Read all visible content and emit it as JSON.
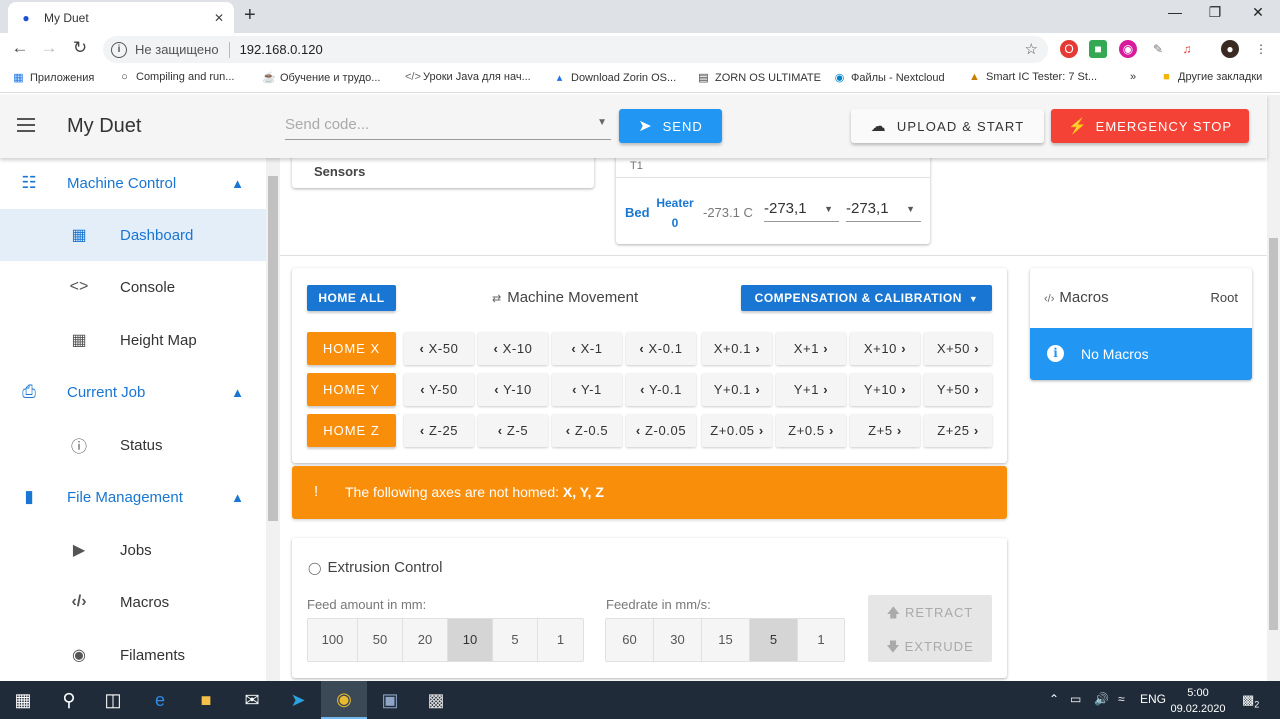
{
  "browser": {
    "tab_title": "My Duet",
    "security_label": "Не защищено",
    "url": "192.168.0.120",
    "bookmarks": [
      "Приложения",
      "Compiling and run...",
      "Обучение и трудо...",
      "Уроки Java для нач...",
      "Download Zorin OS...",
      "ZORN OS ULTIMATE",
      "Файлы - Nextcloud",
      "Smart IC Tester: 7 St...",
      "Другие закладки"
    ],
    "more_bookmarks": "»"
  },
  "appbar": {
    "title": "My Duet",
    "send_placeholder": "Send code...",
    "send_label": "SEND",
    "upload_label": "UPLOAD & START",
    "estop_label": "EMERGENCY STOP"
  },
  "sidebar": {
    "groups": [
      {
        "label": "Machine Control",
        "icon": "tune-icon"
      },
      {
        "label": "Current Job",
        "icon": "printer-icon"
      },
      {
        "label": "File Management",
        "icon": "sd-card-icon"
      }
    ],
    "items": [
      {
        "label": "Dashboard",
        "icon": "dashboard-icon"
      },
      {
        "label": "Console",
        "icon": "code-icon"
      },
      {
        "label": "Height Map",
        "icon": "grid-icon"
      },
      {
        "label": "Status",
        "icon": "info-icon"
      },
      {
        "label": "Jobs",
        "icon": "play-icon"
      },
      {
        "label": "Macros",
        "icon": "code-slash-icon"
      },
      {
        "label": "Filaments",
        "icon": "radio-icon"
      }
    ]
  },
  "sensors": {
    "label": "Sensors"
  },
  "heaters": {
    "tool_label": "T1",
    "bed_label": "Bed",
    "heater_name_line1": "Heater",
    "heater_name_line2": "0",
    "current_temp": "-273.1 C",
    "active_value": "-273,1",
    "standby_value": "-273,1"
  },
  "movement": {
    "home_all": "HOME ALL",
    "title": "Machine Movement",
    "compensation": "COMPENSATION & CALIBRATION",
    "rows": [
      {
        "home": "HOME X",
        "neg": [
          "X-50",
          "X-10",
          "X-1",
          "X-0.1"
        ],
        "pos": [
          "X+0.1",
          "X+1",
          "X+10",
          "X+50"
        ]
      },
      {
        "home": "HOME Y",
        "neg": [
          "Y-50",
          "Y-10",
          "Y-1",
          "Y-0.1"
        ],
        "pos": [
          "Y+0.1",
          "Y+1",
          "Y+10",
          "Y+50"
        ]
      },
      {
        "home": "HOME Z",
        "neg": [
          "Z-25",
          "Z-5",
          "Z-0.5",
          "Z-0.05"
        ],
        "pos": [
          "Z+0.05",
          "Z+0.5",
          "Z+5",
          "Z+25"
        ]
      }
    ]
  },
  "warning": {
    "icon_text": "!",
    "text": "The following axes are not homed: ",
    "axes": "X, Y, Z"
  },
  "extrusion": {
    "title": "Extrusion Control",
    "feed_label": "Feed amount in mm:",
    "feed_values": [
      "100",
      "50",
      "20",
      "10",
      "5",
      "1"
    ],
    "feed_selected": "10",
    "rate_label": "Feedrate in mm/s:",
    "rate_values": [
      "60",
      "30",
      "15",
      "5",
      "1"
    ],
    "rate_selected": "5",
    "retract": "RETRACT",
    "extrude": "EXTRUDE"
  },
  "macros": {
    "title": "Macros",
    "root": "Root",
    "empty": "No Macros"
  },
  "taskbar": {
    "lang": "ENG",
    "time": "5:00",
    "date": "09.02.2020",
    "notifications": "2"
  },
  "colors": {
    "primary": "#1976d2",
    "accent": "#2196f3",
    "warning": "#f98e0b",
    "danger": "#f44336"
  }
}
